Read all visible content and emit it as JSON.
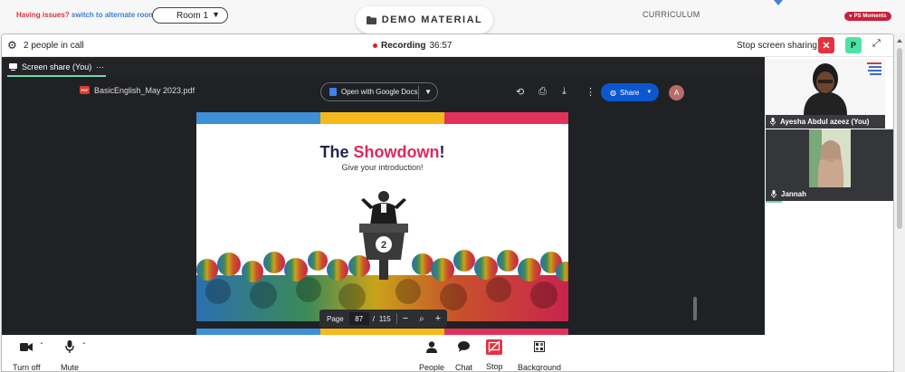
{
  "topbar": {
    "issue_text": "Having issues?",
    "issue_link": "switch to alternate room",
    "room_select": "Room 1",
    "demo_material": "DEMO MATERIAL",
    "curriculum": "CURRICULUM",
    "moments": "PS Moments"
  },
  "call": {
    "people_count": "2 people in call",
    "recording_label": "Recording",
    "recording_time": "36:57",
    "stop_sharing": "Stop screen sharing",
    "p_badge": "P"
  },
  "stage": {
    "tab_label": "Screen share (You)",
    "tab_menu": "···"
  },
  "pdf": {
    "file_name": "BasicEnglish_May 2023.pdf",
    "icon_text": "PDF",
    "open_with": "Open with Google Docs",
    "share": "Share",
    "avatar": "A",
    "page_label": "Page",
    "page_current": "87",
    "page_sep": "/",
    "page_total": "115"
  },
  "slide": {
    "title_a": "The ",
    "title_b": "Showdown",
    "title_c": "!",
    "subtitle": "Give your introduction!",
    "podium_number": "2",
    "bands": [
      "#3f8fd4",
      "#f6b91c",
      "#e0325a"
    ]
  },
  "participants": [
    {
      "name": "Ayesha Abdul azeez (You)"
    },
    {
      "name": "Jannah"
    }
  ],
  "toolbar": {
    "turn_off": "Turn off",
    "mute": "Mute",
    "people": "People",
    "chat": "Chat",
    "stop": "Stop",
    "background": "Background"
  }
}
